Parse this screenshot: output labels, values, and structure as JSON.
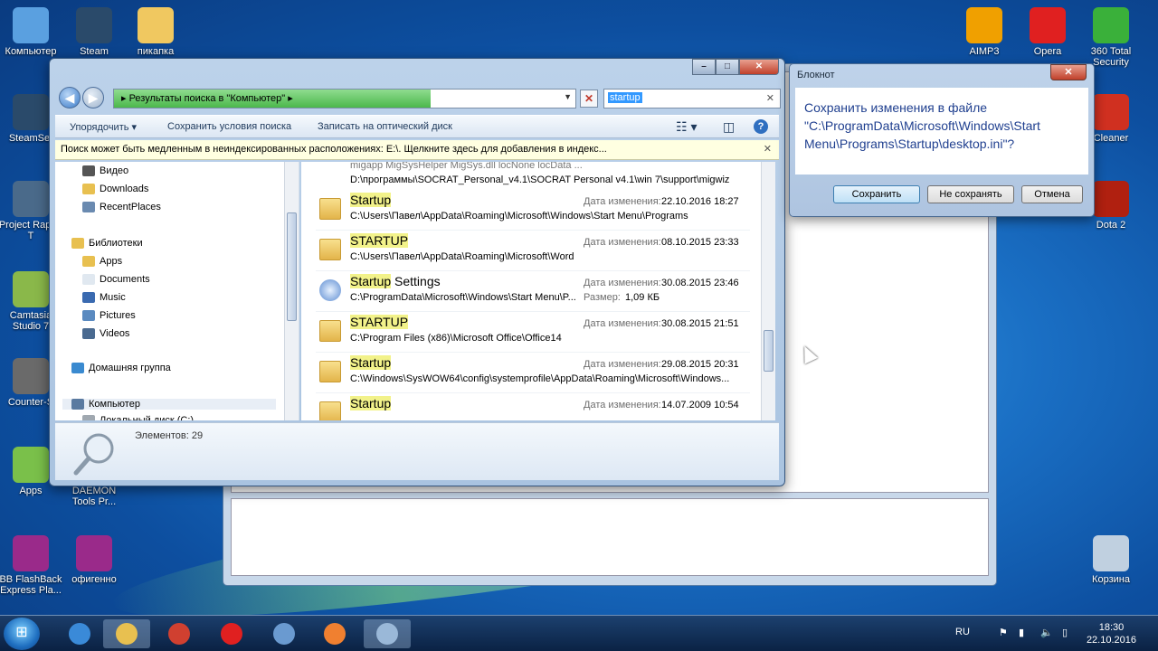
{
  "desktop": {
    "icons": [
      {
        "label": "Компьютер",
        "icon": "computer-icon",
        "color": "#5aa0e0"
      },
      {
        "label": "Steam",
        "icon": "steam-icon",
        "color": "#2a4a6a"
      },
      {
        "label": "пикапка",
        "icon": "folder-icon",
        "color": "#f0c860"
      },
      {
        "label": "SteamSet",
        "icon": "steam-icon",
        "color": "#2a4a6a"
      },
      {
        "label": "Project Raptor T",
        "icon": "game-icon",
        "color": "#4a6a8a"
      },
      {
        "label": "Camtasia Studio 7",
        "icon": "camtasia-icon",
        "color": "#8ab84a"
      },
      {
        "label": "Counter-S",
        "icon": "game-icon",
        "color": "#6a6a6a"
      },
      {
        "label": "Apps",
        "icon": "android-icon",
        "color": "#7ac04a"
      },
      {
        "label": "DAEMON Tools Pr...",
        "icon": "daemon-icon",
        "color": "#333333"
      },
      {
        "label": "BB FlashBack Express Pla...",
        "icon": "video-icon",
        "color": "#9a2a8a"
      },
      {
        "label": "офигенно",
        "icon": "video-icon",
        "color": "#9a2a8a"
      },
      {
        "label": "AIMP3",
        "icon": "aimp-icon",
        "color": "#f0a000"
      },
      {
        "label": "Opera",
        "icon": "opera-icon",
        "color": "#e02020"
      },
      {
        "label": "360 Total Security",
        "icon": "security-icon",
        "color": "#3ab03a"
      },
      {
        "label": "Cleaner",
        "icon": "ccleaner-icon",
        "color": "#d03020"
      },
      {
        "label": "Dota 2",
        "icon": "dota-icon",
        "color": "#b02010"
      },
      {
        "label": "Корзина",
        "icon": "recycle-bin-icon",
        "color": "#c0d0e0"
      }
    ]
  },
  "explorer": {
    "address": "Результаты поиска в \"Компьютер\"",
    "search_value": "startup",
    "toolbar": {
      "organize": "Упорядочить ▾",
      "save_search": "Сохранить условия поиска",
      "burn": "Записать на оптический диск"
    },
    "infobar": "Поиск может быть медленным в неиндексированных расположениях: E:\\. Щелкните здесь для добавления в индекс...",
    "nav": [
      {
        "label": "Видео",
        "icon": "video-library-icon",
        "color": "#555555"
      },
      {
        "label": "Downloads",
        "icon": "folder-icon",
        "color": "#e8c050"
      },
      {
        "label": "RecentPlaces",
        "icon": "recent-places-icon",
        "color": "#6a8ab0"
      },
      {
        "label": "Библиотеки",
        "icon": "libraries-icon",
        "color": "#e8c050"
      },
      {
        "label": "Apps",
        "icon": "folder-icon",
        "color": "#e8c050"
      },
      {
        "label": "Documents",
        "icon": "documents-icon",
        "color": "#e0e8f0"
      },
      {
        "label": "Music",
        "icon": "music-icon",
        "color": "#3a6ab0"
      },
      {
        "label": "Pictures",
        "icon": "pictures-icon",
        "color": "#5a8ac0"
      },
      {
        "label": "Videos",
        "icon": "videos-icon",
        "color": "#4a6a90"
      },
      {
        "label": "Домашняя группа",
        "icon": "homegroup-icon",
        "color": "#3a8ad0"
      },
      {
        "label": "Компьютер",
        "icon": "computer-icon",
        "color": "#5a7aa0"
      },
      {
        "label": "Локальный диск (C:)",
        "icon": "drive-icon",
        "color": "#a0a8b0"
      }
    ],
    "partial_row": {
      "name": "migapp MigSysHelper MigSys.dll locNone locData ...",
      "path": "D:\\программы\\SOCRAT_Personal_v4.1\\SOCRAT Personal v4.1\\win 7\\support\\migwiz"
    },
    "results": [
      {
        "hl": "Startup",
        "rest": "",
        "path": "C:\\Users\\Павел\\AppData\\Roaming\\Microsoft\\Windows\\Start Menu\\Programs",
        "date_label": "Дата изменения:",
        "date": "22.10.2016 18:27",
        "icon": "folder-icon"
      },
      {
        "hl": "STARTUP",
        "rest": "",
        "path": "C:\\Users\\Павел\\AppData\\Roaming\\Microsoft\\Word",
        "date_label": "Дата изменения:",
        "date": "08.10.2015 23:33",
        "icon": "folder-icon"
      },
      {
        "hl": "Startup",
        "rest": " Settings",
        "path": "C:\\ProgramData\\Microsoft\\Windows\\Start Menu\\P...",
        "date_label": "Дата изменения:",
        "date": "30.08.2015 23:46",
        "size_label": "Размер:",
        "size": "1,09 КБ",
        "icon": "shortcut-settings-icon"
      },
      {
        "hl": "STARTUP",
        "rest": "",
        "path": "C:\\Program Files (x86)\\Microsoft Office\\Office14",
        "date_label": "Дата изменения:",
        "date": "30.08.2015 21:51",
        "icon": "folder-icon"
      },
      {
        "hl": "Startup",
        "rest": "",
        "path": "C:\\Windows\\SysWOW64\\config\\systemprofile\\AppData\\Roaming\\Microsoft\\Windows...",
        "date_label": "Дата изменения:",
        "date": "29.08.2015 20:31",
        "icon": "folder-icon"
      },
      {
        "hl": "Startup",
        "rest": "",
        "path": "",
        "date_label": "Дата изменения:",
        "date": "14.07.2009 10:54",
        "icon": "folder-icon"
      }
    ],
    "details": {
      "count": "Элементов: 29"
    }
  },
  "dialog": {
    "title": "Блокнот",
    "close": "✕",
    "message": "Сохранить изменения в файле\n\"C:\\ProgramData\\Microsoft\\Windows\\Start\nMenu\\Programs\\Startup\\desktop.ini\"?",
    "save": "Сохранить",
    "dont_save": "Не сохранять",
    "cancel": "Отмена"
  },
  "taskbar": {
    "language": "RU",
    "time": "18:30",
    "date": "22.10.2016",
    "apps": [
      {
        "icon": "ie-icon",
        "color": "#3a8ad8"
      },
      {
        "icon": "explorer-icon",
        "color": "#e8c050"
      },
      {
        "icon": "chrome-icon",
        "color": "#d04030"
      },
      {
        "icon": "opera-icon",
        "color": "#e02020"
      },
      {
        "icon": "control-panel-icon",
        "color": "#6a9ad0"
      },
      {
        "icon": "media-player-icon",
        "color": "#f08030"
      },
      {
        "icon": "notepad-icon",
        "color": "#9ab8d8"
      }
    ]
  }
}
